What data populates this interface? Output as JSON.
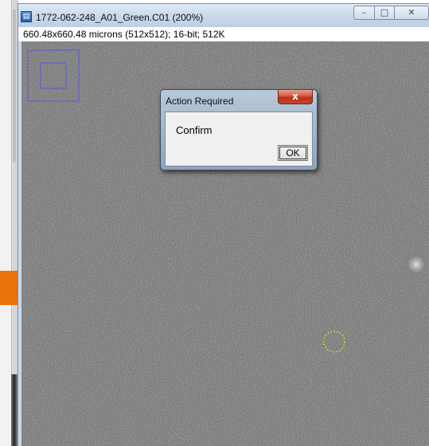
{
  "window": {
    "title": "1772-062-248_A01_Green.C01 (200%)",
    "app_icon": "imagej-window-icon",
    "app_icon_glyph": "▤",
    "controls": {
      "minimize_glyph": "–",
      "maximize_glyph": "□",
      "close_glyph": "✕"
    },
    "image_info": "660.48x660.48 microns (512x512); 16-bit; 512K"
  },
  "dialog": {
    "title": "Action Required",
    "close_glyph": "x",
    "message": "Confirm",
    "ok_label": "OK"
  },
  "colors": {
    "accent_orange": "#e8720c",
    "roi_overview": "#5a5ad6",
    "roi_circle": "#e6e600"
  }
}
